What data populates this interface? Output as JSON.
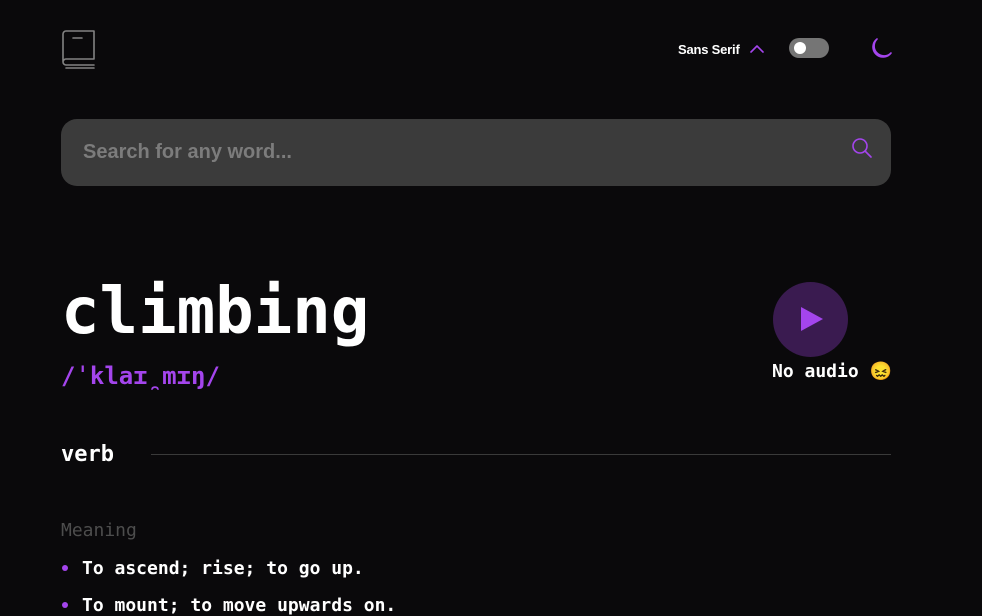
{
  "header": {
    "logo_icon": "book-icon",
    "font": {
      "selected": "Sans Serif",
      "icon": "chevron-up-icon"
    },
    "theme_toggle": {
      "state": "off"
    },
    "theme_icon": "moon-icon"
  },
  "search": {
    "placeholder": "Search for any word...",
    "value": "",
    "icon": "search-icon"
  },
  "entry": {
    "word": "climbing",
    "phonetic": "/ˈklaɪ̯mɪŋ/",
    "play_icon": "play-icon",
    "audio_status": "No audio 😖"
  },
  "meanings": [
    {
      "part_of_speech": "verb",
      "label": "Meaning",
      "definitions": [
        "To ascend; rise; to go up.",
        "To mount; to move upwards on."
      ]
    }
  ],
  "colors": {
    "accent": "#a445ed",
    "background": "#0a090b",
    "search_bg": "#3b3b3b",
    "muted": "#4d4d4d"
  }
}
